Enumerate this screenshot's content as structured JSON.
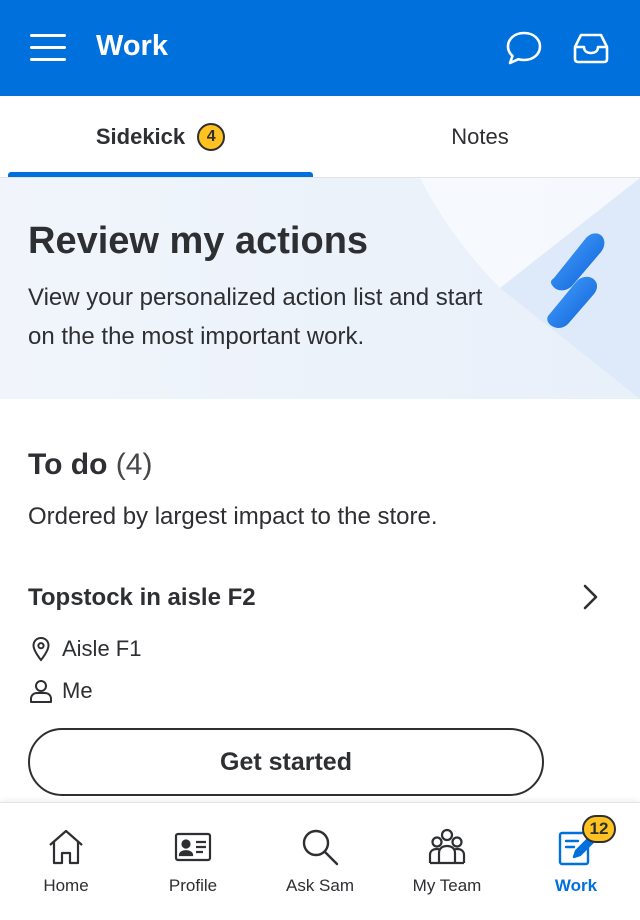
{
  "header": {
    "title": "Work",
    "menu_icon": "hamburger-menu-icon",
    "chat_icon": "chat-bubble-icon",
    "inbox_icon": "inbox-tray-icon",
    "background": "#0071dc"
  },
  "tabs": [
    {
      "label": "Sidekick",
      "badge": "4",
      "selected": true
    },
    {
      "label": "Notes",
      "selected": false
    }
  ],
  "banner": {
    "title": "Review my actions",
    "text": "View your personalized action list and start on the the most important work.",
    "logo_icon": "sidekick-logo-icon"
  },
  "todo": {
    "heading": "To do",
    "count": "(4)",
    "subtitle": "Ordered by largest impact to the store."
  },
  "task": {
    "title": "Topstock in aisle F2",
    "location": "Aisle F1",
    "assignee": "Me",
    "button_label": "Get started"
  },
  "bottom_nav": [
    {
      "label": "Home",
      "icon": "home-icon",
      "active": false
    },
    {
      "label": "Profile",
      "icon": "id-card-icon",
      "active": false
    },
    {
      "label": "Ask Sam",
      "icon": "search-icon",
      "active": false
    },
    {
      "label": "My Team",
      "icon": "team-icon",
      "active": false
    },
    {
      "label": "Work",
      "icon": "work-clipboard-icon",
      "active": true,
      "badge": "12"
    }
  ],
  "colors": {
    "accent": "#0071dc",
    "badge": "#ffc220",
    "text": "#2e2f32"
  }
}
